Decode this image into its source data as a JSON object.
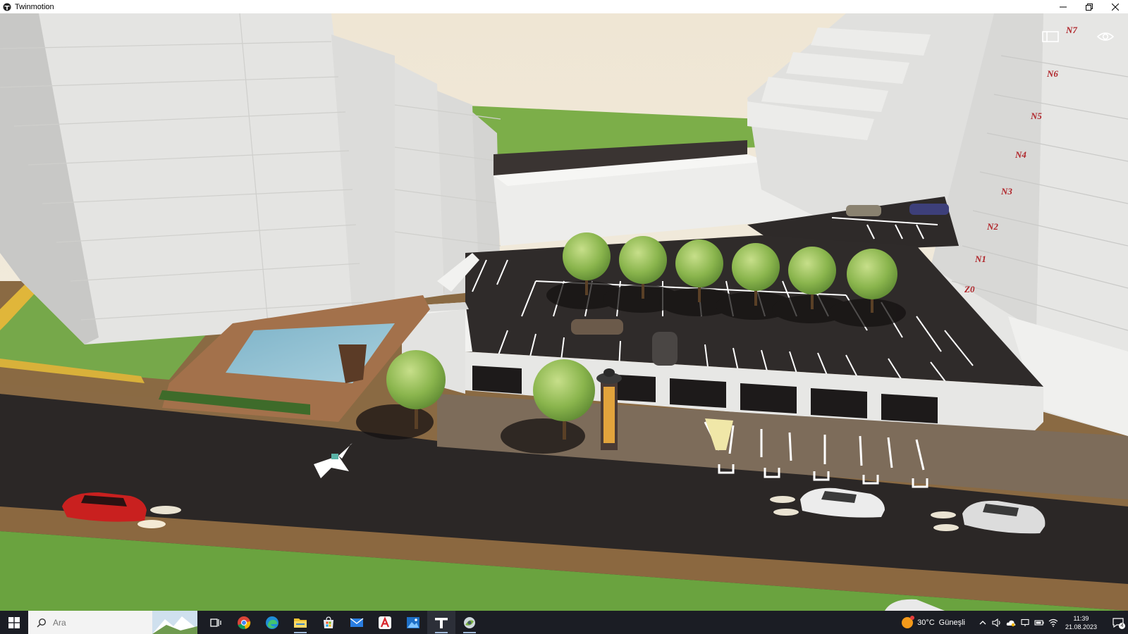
{
  "window": {
    "title": "Twinmotion"
  },
  "viewport": {
    "floor_labels": [
      "N7",
      "N6",
      "N5",
      "N4",
      "N3",
      "N2",
      "N1",
      "Z0"
    ]
  },
  "taskbar": {
    "search_placeholder": "Ara",
    "apps": [
      {
        "icon": "task-view-icon",
        "running": false
      },
      {
        "icon": "chrome-icon",
        "running": false
      },
      {
        "icon": "edge-icon",
        "running": false
      },
      {
        "icon": "file-explorer-icon",
        "running": true
      },
      {
        "icon": "store-icon",
        "running": false
      },
      {
        "icon": "mail-icon",
        "running": false
      },
      {
        "icon": "acrobat-icon",
        "running": false
      },
      {
        "icon": "photos-icon",
        "running": false
      },
      {
        "icon": "twinmotion-icon",
        "running": true
      },
      {
        "icon": "app-icon",
        "running": true
      }
    ],
    "weather": {
      "temp": "30°C",
      "condition": "Güneşli"
    },
    "time": "11:39",
    "date": "21.08.2023",
    "notifications": "4"
  },
  "colors": {
    "sky": "#f1eadb",
    "grass": "#6fa644",
    "building": "#e2e2e0",
    "asphalt": "#2a2726",
    "taskbar": "#1b1d24",
    "floor_label": "#b0252a"
  }
}
